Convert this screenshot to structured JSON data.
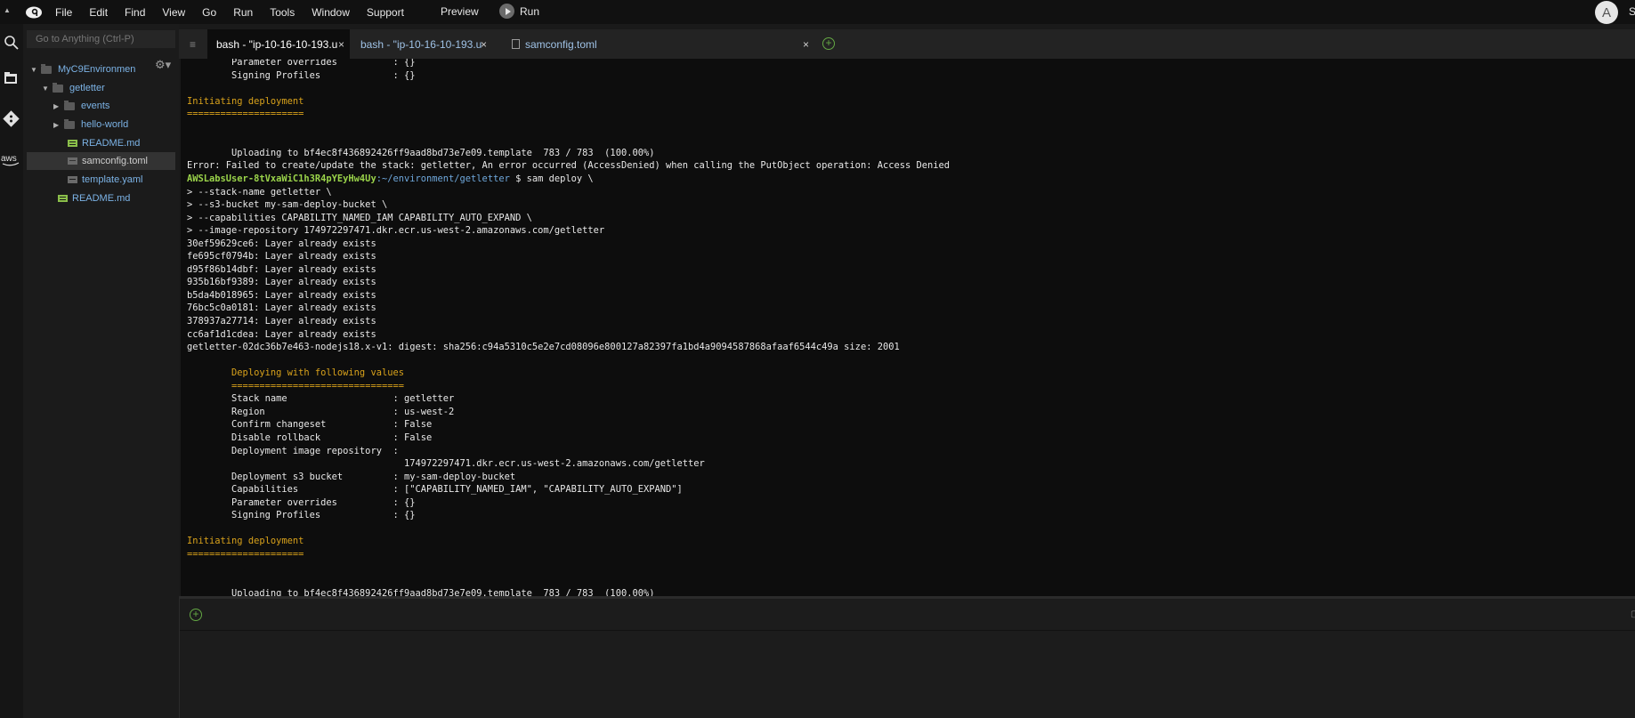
{
  "menubar": {
    "items": [
      "File",
      "Edit",
      "Find",
      "View",
      "Go",
      "Run",
      "Tools",
      "Window",
      "Support"
    ],
    "preview_label": "Preview",
    "run_label": "Run",
    "avatar_initial": "A",
    "share_label": "S"
  },
  "sidebar": {
    "goto_placeholder": "Go to Anything (Ctrl-P)",
    "tree": {
      "root": "MyC9Environmen",
      "getletter": "getletter",
      "events": "events",
      "hello_world": "hello-world",
      "readme_inner": "README.md",
      "samconfig": "samconfig.toml",
      "template": "template.yaml",
      "readme_outer": "README.md"
    }
  },
  "tabs": [
    {
      "label": "bash - \"ip-10-16-10-193.u",
      "close": "×"
    },
    {
      "label": "bash - \"ip-10-16-10-193.u",
      "close": "×"
    },
    {
      "label": "samconfig.toml",
      "close": "×"
    }
  ],
  "terminal": {
    "lines": [
      {
        "text": "        Parameter overrides          : {}",
        "cls": "c-white"
      },
      {
        "text": "        Signing Profiles             : {}",
        "cls": "c-white"
      },
      {
        "text": "",
        "cls": "c-white"
      },
      {
        "text": "Initiating deployment",
        "cls": "c-yellow"
      },
      {
        "text": "=====================",
        "cls": "c-yellow"
      },
      {
        "text": "",
        "cls": "c-white"
      },
      {
        "text": "",
        "cls": "c-white"
      },
      {
        "text": "        Uploading to bf4ec8f436892426ff9aad8bd73e7e09.template  783 / 783  (100.00%)",
        "cls": "c-white"
      },
      {
        "text": "Error: Failed to create/update the stack: getletter, An error occurred (AccessDenied) when calling the PutObject operation: Access Denied",
        "cls": "c-white"
      },
      {
        "prompt_user": "AWSLabsUser-8tVxaWiC1h3R4pYEyHw4Uy",
        "prompt_path": ":~/environment/getletter",
        "prompt_cmd": " $ sam deploy \\"
      },
      {
        "text": "> --stack-name getletter \\",
        "cls": "c-white"
      },
      {
        "text": "> --s3-bucket my-sam-deploy-bucket \\",
        "cls": "c-white"
      },
      {
        "text": "> --capabilities CAPABILITY_NAMED_IAM CAPABILITY_AUTO_EXPAND \\",
        "cls": "c-white"
      },
      {
        "text": "> --image-repository 174972297471.dkr.ecr.us-west-2.amazonaws.com/getletter",
        "cls": "c-white"
      },
      {
        "text": "30ef59629ce6: Layer already exists",
        "cls": "c-white"
      },
      {
        "text": "fe695cf0794b: Layer already exists",
        "cls": "c-white"
      },
      {
        "text": "d95f86b14dbf: Layer already exists",
        "cls": "c-white"
      },
      {
        "text": "935b16bf9389: Layer already exists",
        "cls": "c-white"
      },
      {
        "text": "b5da4b018965: Layer already exists",
        "cls": "c-white"
      },
      {
        "text": "76bc5c0a0181: Layer already exists",
        "cls": "c-white"
      },
      {
        "text": "378937a27714: Layer already exists",
        "cls": "c-white"
      },
      {
        "text": "cc6af1d1cdea: Layer already exists",
        "cls": "c-white"
      },
      {
        "text": "getletter-02dc36b7e463-nodejs18.x-v1: digest: sha256:c94a5310c5e2e7cd08096e800127a82397fa1bd4a9094587868afaaf6544c49a size: 2001",
        "cls": "c-white"
      },
      {
        "text": "",
        "cls": "c-white"
      },
      {
        "text": "        Deploying with following values",
        "cls": "c-yellow"
      },
      {
        "text": "        ===============================",
        "cls": "c-yellow"
      },
      {
        "text": "        Stack name                   : getletter",
        "cls": "c-white"
      },
      {
        "text": "        Region                       : us-west-2",
        "cls": "c-white"
      },
      {
        "text": "        Confirm changeset            : False",
        "cls": "c-white"
      },
      {
        "text": "        Disable rollback             : False",
        "cls": "c-white"
      },
      {
        "text": "        Deployment image repository  : ",
        "cls": "c-white"
      },
      {
        "text": "                                       174972297471.dkr.ecr.us-west-2.amazonaws.com/getletter",
        "cls": "c-white"
      },
      {
        "text": "        Deployment s3 bucket         : my-sam-deploy-bucket",
        "cls": "c-white"
      },
      {
        "text": "        Capabilities                 : [\"CAPABILITY_NAMED_IAM\", \"CAPABILITY_AUTO_EXPAND\"]",
        "cls": "c-white"
      },
      {
        "text": "        Parameter overrides          : {}",
        "cls": "c-white"
      },
      {
        "text": "        Signing Profiles             : {}",
        "cls": "c-white"
      },
      {
        "text": "",
        "cls": "c-white"
      },
      {
        "text": "Initiating deployment",
        "cls": "c-yellow"
      },
      {
        "text": "=====================",
        "cls": "c-yellow"
      },
      {
        "text": "",
        "cls": "c-white"
      },
      {
        "text": "",
        "cls": "c-white"
      },
      {
        "text": "        Uploading to bf4ec8f436892426ff9aad8bd73e7e09.template  783 / 783  (100.00%)",
        "cls": "c-white"
      },
      {
        "text": "Error: Failed to create/update the stack: getletter, An error occurred (AccessDenied) when calling the PutObject operation: Access Denied",
        "cls": "c-white"
      },
      {
        "prompt_user": "AWSLabsUser-8tVxaWiC1h3R4pYEyHw4Uy",
        "prompt_path": ":~/environment/getletter",
        "prompt_cmd": " $ ",
        "cursor": true
      }
    ]
  },
  "colors": {
    "accent_green": "#64a844",
    "terminal_yellow": "#d9a21b",
    "prompt_green": "#9ad34a",
    "prompt_blue": "#6fa8dc"
  },
  "icons": [
    "cloud9-logo-icon",
    "search-icon",
    "files-icon",
    "git-icon",
    "aws-icon",
    "gear-icon",
    "folder-icon",
    "file-icon",
    "add-tab-icon",
    "close-icon",
    "play-icon",
    "menu-icon"
  ]
}
